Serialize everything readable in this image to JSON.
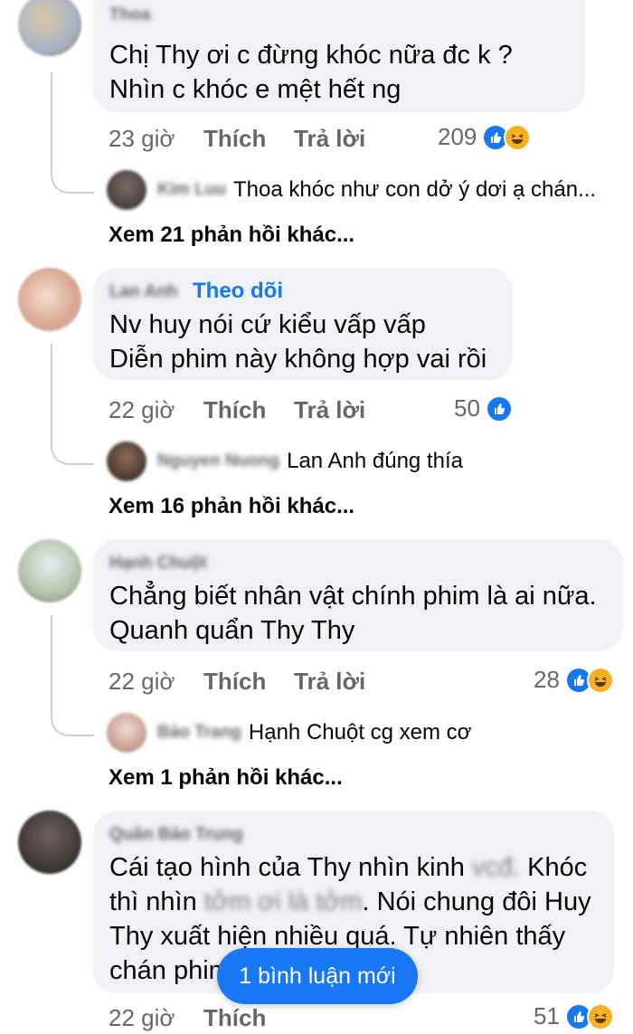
{
  "comments": [
    {
      "author": "Thoa",
      "lines": [
        "Chị Thy ơi c đừng khóc nữa đc k ?",
        "Nhìn c khóc e mệt hết ng"
      ],
      "time": "23 giờ",
      "like": "Thích",
      "reply": "Trả lời",
      "count": "209",
      "reactions": [
        "like-icon",
        "haha-icon"
      ],
      "reply_preview": {
        "author": "Kim Luu",
        "text": "Thoa khóc như con dở ý dơi ạ chán..."
      },
      "more": "Xem 21 phản hồi khác..."
    },
    {
      "author": "Lan Anh",
      "follow": "Theo dõi",
      "lines": [
        "Nv huy nói cứ kiểu vấp vấp",
        "Diễn phim này không hợp vai rồi"
      ],
      "time": "22 giờ",
      "like": "Thích",
      "reply": "Trả lời",
      "count": "50",
      "reactions": [
        "like-icon"
      ],
      "reply_preview": {
        "author": "Nguyen Nuong",
        "text": "Lan Anh đúng thía"
      },
      "more": "Xem 16 phản hồi khác..."
    },
    {
      "author": "Hạnh Chuột",
      "lines": [
        "Chẳng biết nhân vật chính phim là ai nữa.",
        "Quanh quẩn Thy Thy"
      ],
      "time": "22 giờ",
      "like": "Thích",
      "reply": "Trả lời",
      "count": "28",
      "reactions": [
        "like-icon",
        "haha-icon"
      ],
      "reply_preview": {
        "author": "Bảo Trang",
        "text": "Hạnh Chuột cg xem cơ"
      },
      "more": "Xem 1 phản hồi khác..."
    },
    {
      "author": "Quân Bảo Trung",
      "line1_a": "Cái tạo hình của Thy nhìn kinh",
      "line1_blur": " vcđ.",
      "line1_b": " Khóc",
      "line2_a": "thì nhìn",
      "line2_blur": " tởm ơi là tởm",
      "line2_b": ". Nói chung đôi Huy",
      "line3": "Thy xuất hiện nhiều quá. Tự nhiên thấy",
      "line4": "chán phim",
      "time": "22 giờ",
      "like": "Thích",
      "count": "51",
      "reactions": [
        "like-icon",
        "haha-icon"
      ]
    }
  ],
  "new_comment_button": "1 bình luận mới",
  "colors": {
    "accent": "#1877f2",
    "bubble": "#f0f2f5",
    "meta": "#65676b",
    "haha": "#f7b125"
  }
}
